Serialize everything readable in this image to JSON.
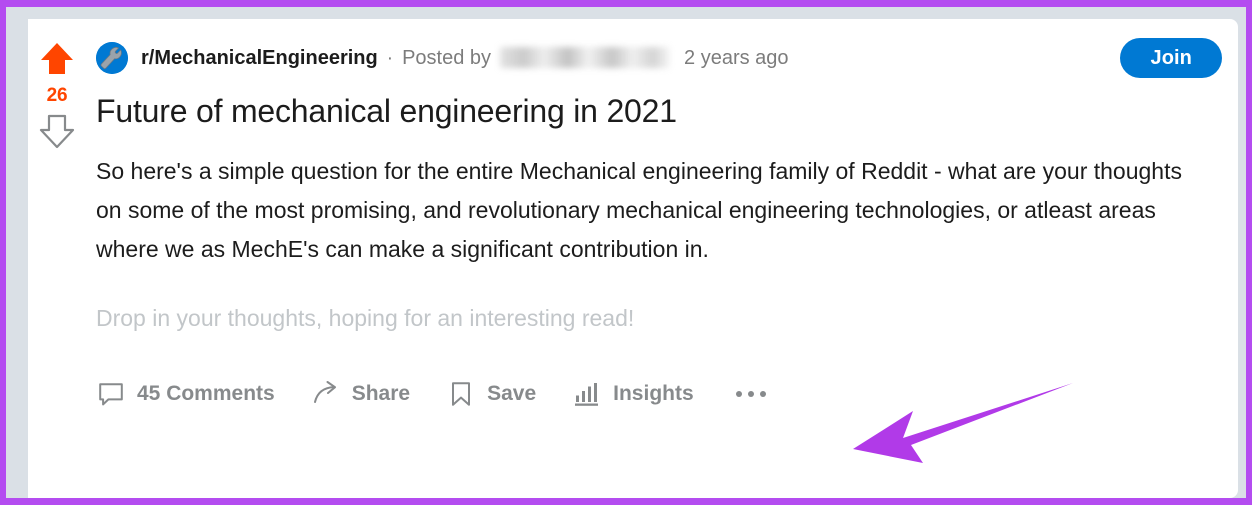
{
  "annotation": {
    "frame_border_color": "#b44cf0",
    "arrow_color": "#b13ae8",
    "arrow_name": "purple-callout-arrow",
    "arrow_points_to": "more-options-button"
  },
  "page": {
    "background_color": "#dae0e6",
    "card_background": "#ffffff"
  },
  "vote": {
    "score": "26",
    "score_color": "#ff4500",
    "upvote_state": "upvoted",
    "upvote_color": "#ff4500",
    "downvote_color": "#878a8c"
  },
  "post": {
    "subreddit": "r/MechanicalEngineering",
    "subreddit_avatar_icon": "wrench-icon",
    "avatar_background": "#0079d3",
    "separator": "·",
    "posted_by_label": "Posted by",
    "username": "",
    "username_redacted": true,
    "timestamp": "2 years ago",
    "join_label": "Join",
    "join_color": "#0079d3",
    "title": "Future of mechanical engineering in 2021",
    "body_paragraph": "So here's a simple question for the entire Mechanical engineering family of Reddit - what are your thoughts on some of the most promising, and revolutionary mechanical engineering technologies, or atleast areas where we as MechE's can make a significant contribution in.",
    "body_faded": "Drop in your thoughts, hoping for an interesting read!"
  },
  "actions": [
    {
      "label": "45 Comments",
      "icon": "comment-bubble-icon",
      "name": "comments-button"
    },
    {
      "label": "Share",
      "icon": "share-arrow-icon",
      "name": "share-button"
    },
    {
      "label": "Save",
      "icon": "bookmark-icon",
      "name": "save-button"
    },
    {
      "label": "Insights",
      "icon": "bar-chart-icon",
      "name": "insights-button"
    }
  ],
  "more_options": {
    "name": "more-options-button",
    "icon": "ellipsis-icon",
    "dot_count": 3
  }
}
